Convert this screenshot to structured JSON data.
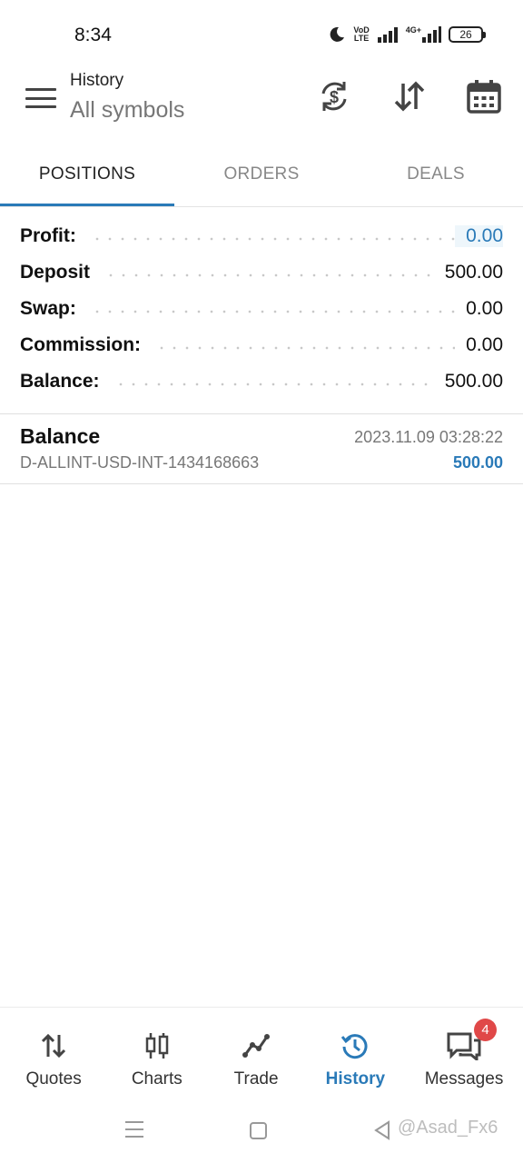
{
  "status_bar": {
    "time": "8:34",
    "network_label_top": "VoD",
    "network_label_bottom": "LTE",
    "mobile_type": "4G+",
    "battery": "26"
  },
  "toolbar": {
    "title": "History",
    "subtitle": "All symbols",
    "icons": [
      "menu-icon",
      "currency-exchange-icon",
      "sort-icon",
      "calendar-icon"
    ]
  },
  "tabs": [
    {
      "label": "POSITIONS",
      "active": true
    },
    {
      "label": "ORDERS",
      "active": false
    },
    {
      "label": "DEALS",
      "active": false
    }
  ],
  "summary": [
    {
      "label": "Profit:",
      "value": "0.00"
    },
    {
      "label": "Deposit",
      "value": "500.00"
    },
    {
      "label": "Swap:",
      "value": "0.00"
    },
    {
      "label": "Commission:",
      "value": "0.00"
    },
    {
      "label": "Balance:",
      "value": "500.00"
    }
  ],
  "deal": {
    "type": "Balance",
    "time": "2023.11.09 03:28:22",
    "account": "D-ALLINT-USD-INT-1434168663",
    "amount": "500.00"
  },
  "bottom_nav": [
    {
      "label": "Quotes",
      "icon": "quotes-icon"
    },
    {
      "label": "Charts",
      "icon": "candlestick-chart-icon"
    },
    {
      "label": "Trade",
      "icon": "trade-line-icon"
    },
    {
      "label": "History",
      "icon": "history-icon",
      "active": true
    },
    {
      "label": "Messages",
      "icon": "messages-icon",
      "badge": "4"
    }
  ],
  "watermark": "@Asad_Fx6",
  "colors": {
    "accent": "#2a7ab8",
    "badge": "#e04848",
    "muted_text": "#777777"
  }
}
